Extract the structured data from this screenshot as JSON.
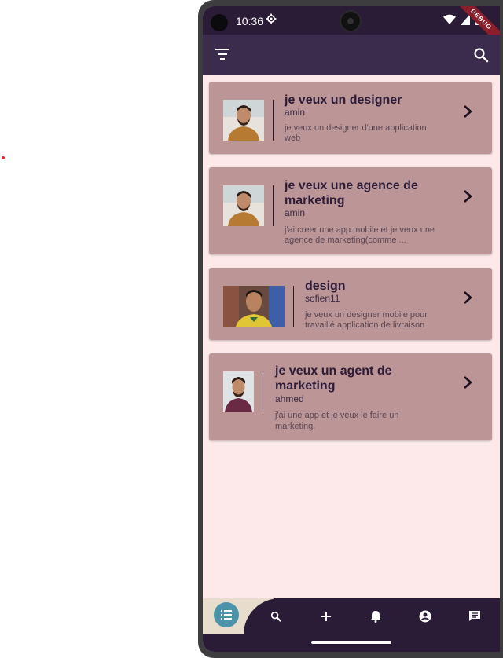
{
  "status_bar": {
    "time": "10:36"
  },
  "debug_ribbon": "DEBUG",
  "app_bar": {
    "filter_icon": "filter-icon",
    "search_icon": "search-icon"
  },
  "posts": [
    {
      "title_line1": "je veux un designer",
      "title_line2": "",
      "author": "amin",
      "desc_line1": "je veux un designer d'une application",
      "desc_line2": "web"
    },
    {
      "title_line1": "je veux une agence de",
      "title_line2": "marketing",
      "author": "amin",
      "desc_line1": "j'ai creer une app mobile et je veux une",
      "desc_line2": "agence de marketing(comme ..."
    },
    {
      "title_line1": "design",
      "title_line2": "",
      "author": "sofien11",
      "desc_line1": "je veux un designer mobile pour",
      "desc_line2": "travaillé application de livraison"
    },
    {
      "title_line1": "je veux un agent de",
      "title_line2": "marketing",
      "author": "ahmed",
      "desc_line1": "j'ai une app et je veux le faire un",
      "desc_line2": "marketing."
    }
  ],
  "bottom_nav": [
    "list-icon",
    "search-icon",
    "add-icon",
    "bell-icon",
    "account-icon",
    "chat-icon"
  ],
  "colors": {
    "app_bar": "#3b2b4d",
    "card": "#bc9597",
    "background": "#fde9ea",
    "fab": "#4b93a8"
  }
}
